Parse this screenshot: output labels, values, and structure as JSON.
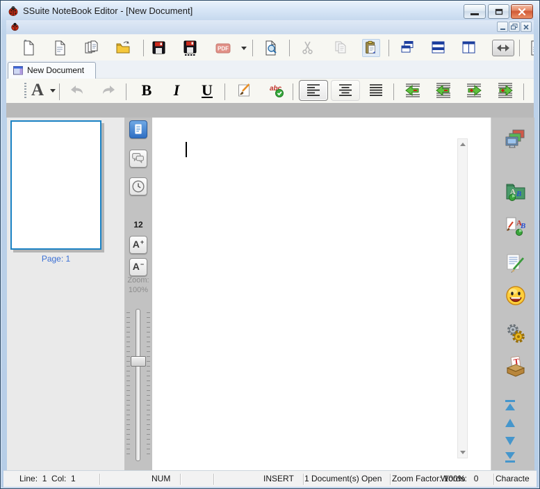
{
  "window": {
    "title": "SSuite NoteBook Editor - [New Document]"
  },
  "tab_bar": {
    "tabs": [
      {
        "label": "New Document"
      }
    ]
  },
  "toolbar_main": {
    "pdf_label": "PDF"
  },
  "toolbar_format": {
    "font_button_label": "A",
    "bold_label": "B",
    "italic_label": "I",
    "underline_label": "U",
    "spell_abc": "abc"
  },
  "left_panel": {
    "page_label": "Page: 1"
  },
  "tool_strip": {
    "font_size": "12",
    "increase_label": "A",
    "increase_sign": "+",
    "decrease_label": "A",
    "decrease_sign": "−",
    "zoom_label": "Zoom:",
    "zoom_value": "100%"
  },
  "editor": {
    "content": ""
  },
  "right_panel": {
    "dictionary_a": "A",
    "dictionary_b": "B",
    "format_a": "A",
    "format_b": "B",
    "stamp_t": "T"
  },
  "status_bar": {
    "line_col": "Line:  1  Col:  1",
    "num": "NUM",
    "insert": "INSERT",
    "docs_open": "1 Document(s) Open",
    "zoom_factor": "Zoom Factor: 100%",
    "words": "Words:   0",
    "characters": "Characte"
  },
  "colors": {
    "thumbnail_border": "#1a82c4",
    "page_label_blue": "#3a6fd4",
    "nav_arrow_blue": "#4596cc",
    "close_button_red": "#d05a36",
    "active_tool_blue": "#2f6fc4"
  },
  "icons": {
    "app": "ladybug-icon",
    "title_controls": [
      "minimize-icon",
      "maximize-icon",
      "close-icon"
    ],
    "mdi_controls": [
      "minimize-icon",
      "restore-icon",
      "close-icon"
    ],
    "main_toolbar": [
      "new-document-icon",
      "new-from-template-icon",
      "duplicate-document-icon",
      "open-folder-icon",
      "save-icon",
      "save-as-icon",
      "pdf-export-icon",
      "dropdown-arrow-icon",
      "print-preview-icon",
      "cut-icon",
      "copy-icon",
      "paste-icon",
      "cascade-windows-icon",
      "tile-horizontal-icon",
      "tile-vertical-icon",
      "toggle-width-icon",
      "document-clipped-icon"
    ],
    "format_toolbar": [
      "font-icon",
      "undo-icon",
      "redo-icon",
      "bold-icon",
      "italic-icon",
      "underline-icon",
      "format-brush-icon",
      "spell-check-icon",
      "align-left-icon",
      "align-center-icon",
      "justify-icon",
      "outdent-line-icon",
      "outdent-paragraph-icon",
      "indent-line-icon",
      "indent-paragraph-icon"
    ],
    "tool_strip": [
      "page-view-icon",
      "comments-icon",
      "history-icon",
      "font-larger-icon",
      "font-smaller-icon",
      "zoom-slider"
    ],
    "right_panel": [
      "screens-icon",
      "reference-folder-icon",
      "format-page-icon",
      "notes-icon",
      "smiley-icon",
      "settings-gears-icon",
      "text-stamp-icon",
      "scroll-top-icon",
      "scroll-up-icon",
      "scroll-down-icon",
      "scroll-bottom-icon"
    ],
    "tab": "document-window-icon"
  }
}
